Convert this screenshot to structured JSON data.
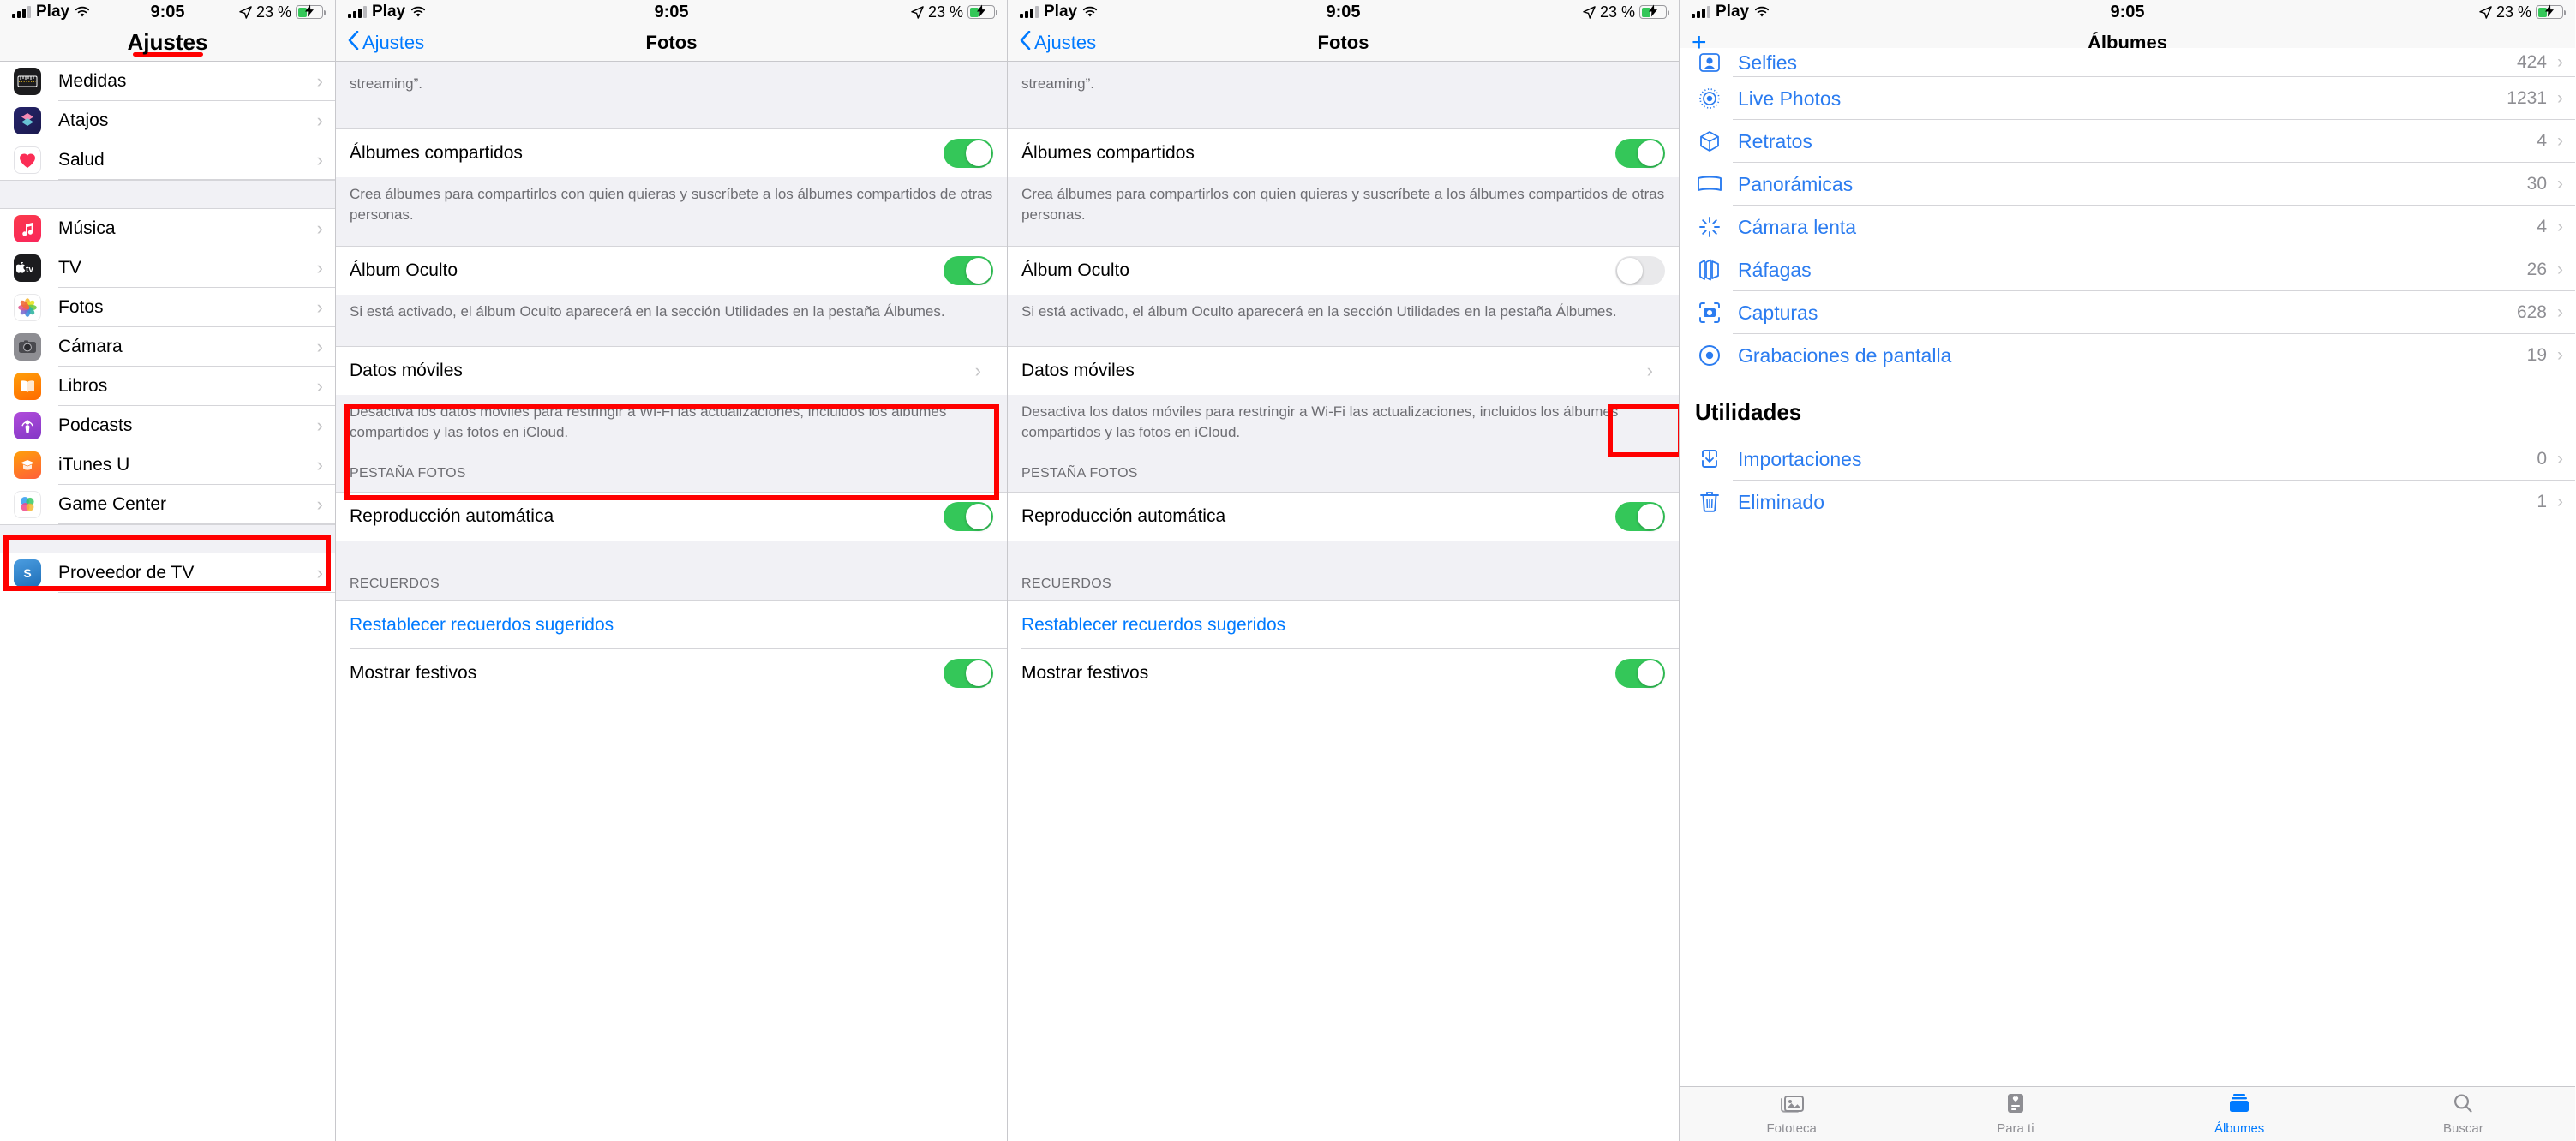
{
  "status_bar": {
    "carrier": "Play",
    "time": "9:05",
    "battery_percent": "23 %",
    "signal_icon": "cellular-bars-icon",
    "wifi_icon": "wifi-icon",
    "location_icon": "location-arrow-icon",
    "battery_icon": "battery-charging-icon"
  },
  "colors": {
    "accent_blue": "#007aff",
    "album_blue": "#2b7cf0",
    "toggle_on_green": "#34c759",
    "annotation_red": "#ff0000",
    "group_bg": "#f1f1f5",
    "secondary_text": "#6d6d72"
  },
  "panel1": {
    "nav_title": "Ajustes",
    "items": [
      {
        "label": "Medidas",
        "icon": "measure-app-icon"
      },
      {
        "label": "Atajos",
        "icon": "shortcuts-app-icon"
      },
      {
        "label": "Salud",
        "icon": "health-app-icon"
      },
      {
        "label": "Música",
        "icon": "music-app-icon"
      },
      {
        "label": "TV",
        "icon": "tv-app-icon"
      },
      {
        "label": "Fotos",
        "icon": "photos-app-icon"
      },
      {
        "label": "Cámara",
        "icon": "camera-app-icon"
      },
      {
        "label": "Libros",
        "icon": "books-app-icon"
      },
      {
        "label": "Podcasts",
        "icon": "podcasts-app-icon"
      },
      {
        "label": "iTunes U",
        "icon": "itunesu-app-icon"
      },
      {
        "label": "Game Center",
        "icon": "gamecenter-app-icon"
      },
      {
        "label": "Proveedor de TV",
        "icon": "tvprovider-app-icon"
      }
    ]
  },
  "panel2": {
    "back_label": "Ajustes",
    "nav_title": "Fotos",
    "top_partial_text": "streaming”.",
    "rows": [
      {
        "label": "Álbumes compartidos",
        "type": "toggle",
        "state": "on"
      }
    ],
    "shared_albums_footer": "Crea álbumes para compartirlos con quien quieras y suscríbete a los álbumes compartidos de otras personas.",
    "hidden_album": {
      "label": "Álbum Oculto",
      "type": "toggle",
      "state": "on"
    },
    "hidden_album_footer": "Si está activado, el álbum Oculto aparecerá en la sección Utilidades en la pestaña Álbumes.",
    "cellular": {
      "label": "Datos móviles",
      "type": "disclosure"
    },
    "cellular_footer": "Desactiva los datos móviles para restringir a Wi-Fi las actualizaciones, incluidos los álbumes compartidos y las fotos en iCloud.",
    "photos_tab_header": "PESTAÑA FOTOS",
    "autoplay": {
      "label": "Reproducción automática",
      "type": "toggle",
      "state": "on"
    },
    "memories_header": "RECUERDOS",
    "reset_memories": "Restablecer recuerdos sugeridos",
    "show_holidays": {
      "label": "Mostrar festivos",
      "type": "toggle",
      "state": "on"
    }
  },
  "panel3": {
    "back_label": "Ajustes",
    "nav_title": "Fotos",
    "top_partial_text": "streaming”.",
    "rows": [
      {
        "label": "Álbumes compartidos",
        "type": "toggle",
        "state": "on"
      }
    ],
    "shared_albums_footer": "Crea álbumes para compartirlos con quien quieras y suscríbete a los álbumes compartidos de otras personas.",
    "hidden_album": {
      "label": "Álbum Oculto",
      "type": "toggle",
      "state": "off"
    },
    "hidden_album_footer": "Si está activado, el álbum Oculto aparecerá en la sección Utilidades en la pestaña Álbumes.",
    "cellular": {
      "label": "Datos móviles",
      "type": "disclosure"
    },
    "cellular_footer": "Desactiva los datos móviles para restringir a Wi-Fi las actualizaciones, incluidos los álbumes compartidos y las fotos en iCloud.",
    "photos_tab_header": "PESTAÑA FOTOS",
    "autoplay": {
      "label": "Reproducción automática",
      "type": "toggle",
      "state": "on"
    },
    "memories_header": "RECUERDOS",
    "reset_memories": "Restablecer recuerdos sugeridos",
    "show_holidays": {
      "label": "Mostrar festivos",
      "type": "toggle",
      "state": "on"
    }
  },
  "panel4": {
    "nav_title": "Álbumes",
    "add_button": "+",
    "albums": [
      {
        "label": "Selfies",
        "count": "424",
        "icon": "selfie-icon"
      },
      {
        "label": "Live Photos",
        "count": "1231",
        "icon": "live-photo-icon"
      },
      {
        "label": "Retratos",
        "count": "4",
        "icon": "portrait-cube-icon"
      },
      {
        "label": "Panorámicas",
        "count": "30",
        "icon": "panorama-icon"
      },
      {
        "label": "Cámara lenta",
        "count": "4",
        "icon": "slow-motion-icon"
      },
      {
        "label": "Ráfagas",
        "count": "26",
        "icon": "burst-icon"
      },
      {
        "label": "Capturas",
        "count": "628",
        "icon": "screenshot-icon"
      },
      {
        "label": "Grabaciones de pantalla",
        "count": "19",
        "icon": "screen-recording-icon"
      }
    ],
    "utilities_title": "Utilidades",
    "utilities": [
      {
        "label": "Importaciones",
        "count": "0",
        "icon": "import-icon"
      },
      {
        "label": "Eliminado",
        "count": "1",
        "icon": "trash-icon"
      }
    ],
    "tabs": [
      {
        "label": "Fototeca",
        "icon": "photo-library-icon",
        "active": false
      },
      {
        "label": "Para ti",
        "icon": "for-you-icon",
        "active": false
      },
      {
        "label": "Álbumes",
        "icon": "albums-icon",
        "active": true
      },
      {
        "label": "Buscar",
        "icon": "search-icon",
        "active": false
      }
    ]
  }
}
